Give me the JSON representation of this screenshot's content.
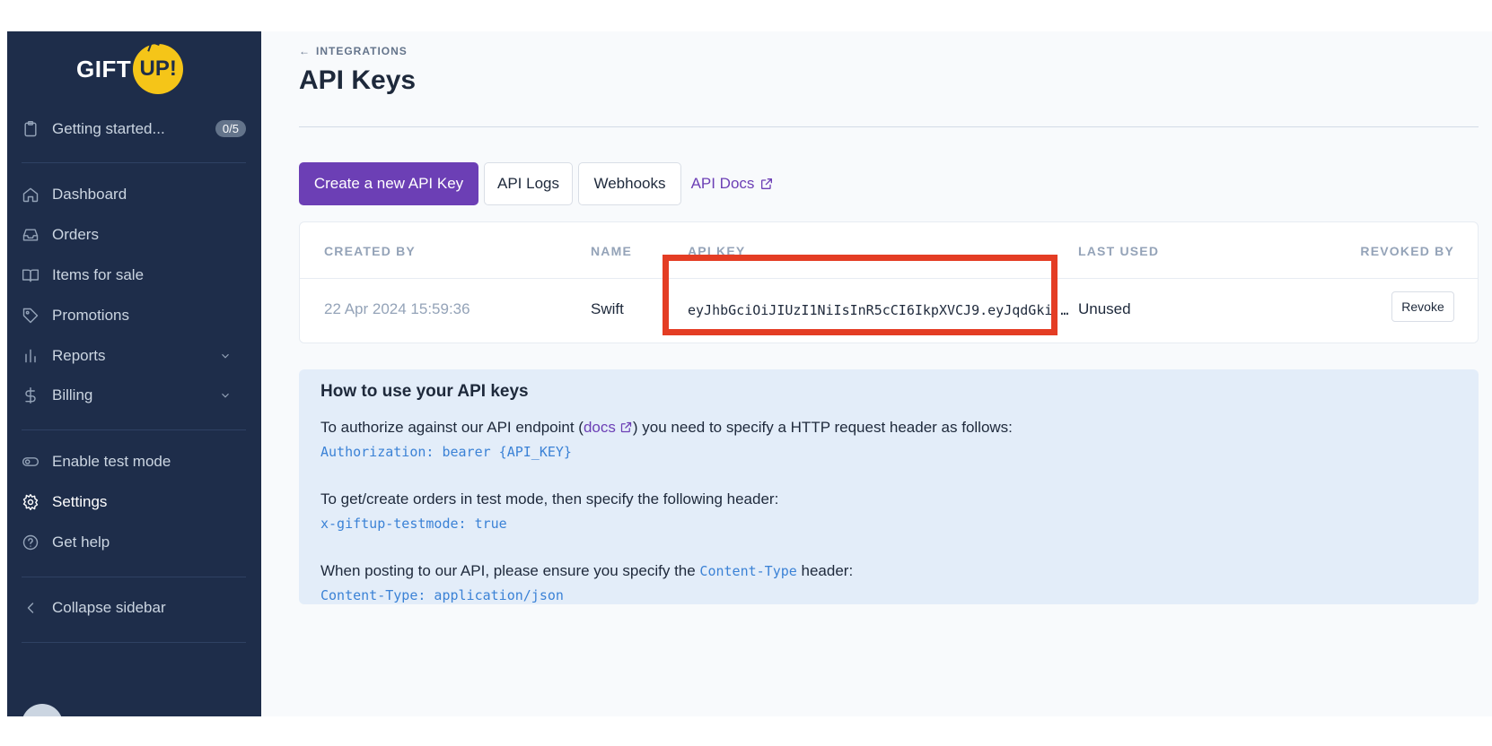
{
  "logo": {
    "left": "GIFT",
    "right": "UP!"
  },
  "sidebar": {
    "getting_started": {
      "label": "Getting started...",
      "badge": "0/5"
    },
    "items": [
      {
        "label": "Dashboard",
        "icon": "home-icon"
      },
      {
        "label": "Orders",
        "icon": "inbox-icon"
      },
      {
        "label": "Items for sale",
        "icon": "book-icon"
      },
      {
        "label": "Promotions",
        "icon": "tag-icon"
      },
      {
        "label": "Reports",
        "icon": "bar-chart-icon"
      },
      {
        "label": "Billing",
        "icon": "dollar-icon"
      }
    ],
    "test_mode": "Enable test mode",
    "settings": "Settings",
    "help": "Get help",
    "collapse": "Collapse sidebar"
  },
  "header": {
    "breadcrumb": "INTEGRATIONS",
    "title": "API Keys"
  },
  "toolbar": {
    "create": "Create a new API Key",
    "logs": "API Logs",
    "webhooks": "Webhooks",
    "docs": "API Docs"
  },
  "table": {
    "columns": [
      "CREATED BY",
      "NAME",
      "API KEY",
      "LAST USED",
      "REVOKED BY"
    ],
    "rows": [
      {
        "created": "22 Apr 2024 15:59:36",
        "name": "Swift",
        "key": "eyJhbGciOiJIUzI1NiIsInR5cCI6IkpXVCJ9.eyJqdGki...",
        "last_used": "Unused",
        "action": "Revoke"
      }
    ]
  },
  "info": {
    "title": "How to use your API keys",
    "line1_pre": "To authorize against our API endpoint (",
    "line1_link": "docs",
    "line1_post": ") you need to specify a HTTP request header as follows:",
    "code1": "Authorization: bearer {API_KEY}",
    "line2": "To get/create orders in test mode, then specify the following header:",
    "code2": "x-giftup-testmode: true",
    "line3_pre": "When posting to our API, please ensure you specify the ",
    "line3_code": "Content-Type",
    "line3_post": " header:",
    "code3": "Content-Type: application/json"
  },
  "colors": {
    "sidebar": "#1e2d4a",
    "accent": "#6c3fb5",
    "highlight": "#e43d24",
    "info_bg": "#e3edf9"
  }
}
